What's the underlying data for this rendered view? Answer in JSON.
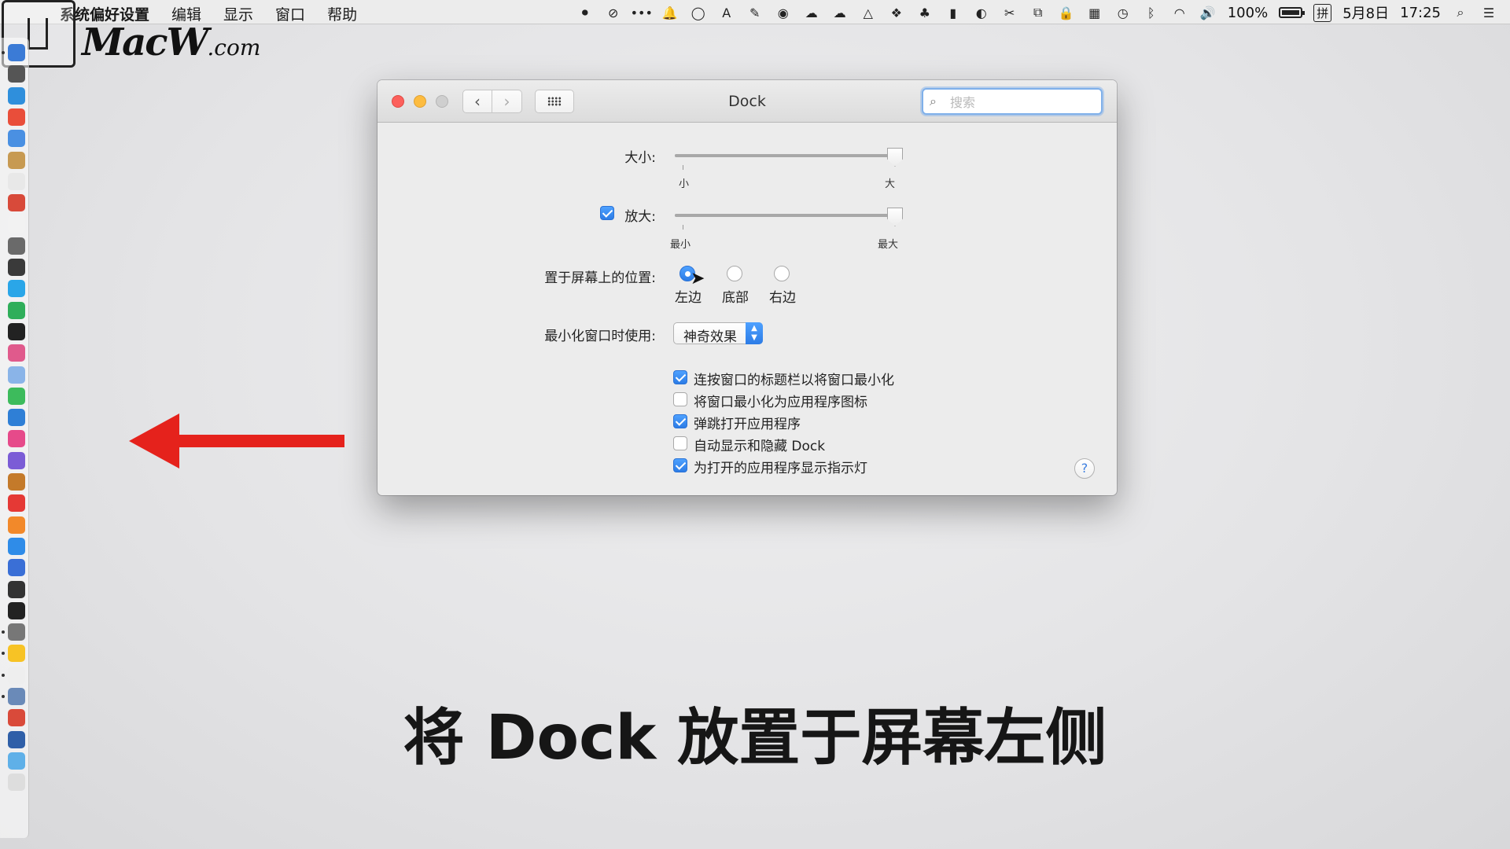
{
  "menubar": {
    "apple": "",
    "items": [
      "系统偏好设置",
      "编辑",
      "显示",
      "窗口",
      "帮助"
    ],
    "battery_percent": "100%",
    "battery_level": 1.0,
    "input_method": "拼",
    "date": "5月8日",
    "time": "17:25"
  },
  "logo": {
    "brand": "MacW",
    "domain": ".com"
  },
  "window": {
    "title": "Dock",
    "search_placeholder": "搜索",
    "size": {
      "label": "大小:",
      "min_label": "小",
      "max_label": "大",
      "value": 1.0
    },
    "magnification": {
      "label": "放大:",
      "checked": true,
      "min_label": "最小",
      "max_label": "最大",
      "value": 1.0
    },
    "position": {
      "label": "置于屏幕上的位置:",
      "options": [
        "左边",
        "底部",
        "右边"
      ],
      "selected": "左边"
    },
    "minimize": {
      "label": "最小化窗口时使用:",
      "value": "神奇效果"
    },
    "checkboxes": [
      {
        "label": "连按窗口的标题栏以将窗口最小化",
        "checked": true
      },
      {
        "label": "将窗口最小化为应用程序图标",
        "checked": false
      },
      {
        "label": "弹跳打开应用程序",
        "checked": true
      },
      {
        "label": "自动显示和隐藏 Dock",
        "checked": false
      },
      {
        "label": "为打开的应用程序显示指示灯",
        "checked": true
      }
    ],
    "help": "?"
  },
  "caption": "将 Dock 放置于屏幕左侧",
  "colors": {
    "accent": "#2c7ce6",
    "arrow": "#e5221c",
    "close": "#fc605c",
    "minimize": "#fdbc40"
  }
}
